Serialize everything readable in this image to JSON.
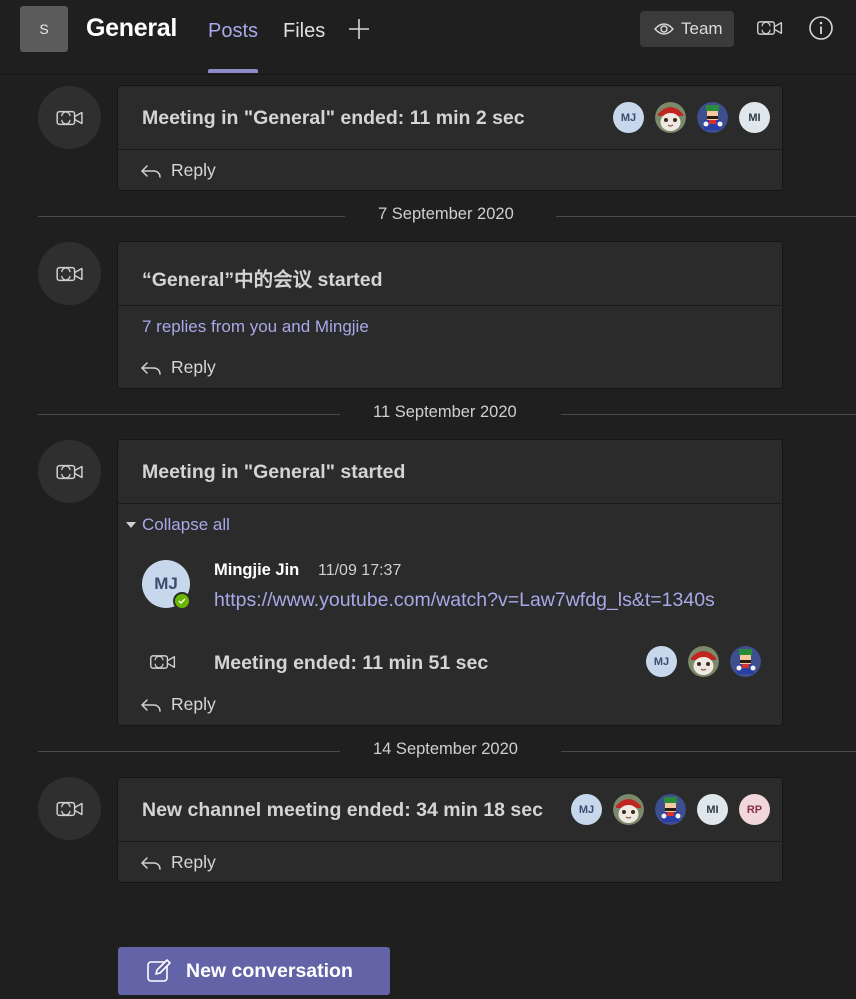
{
  "header": {
    "team_avatar_letter": "S",
    "channel_name": "General",
    "tabs": [
      {
        "label": "Posts",
        "active": true
      },
      {
        "label": "Files",
        "active": false
      }
    ],
    "team_button_label": "Team",
    "icons": [
      "eye-icon",
      "add-icon",
      "video-call-icon",
      "info-icon"
    ]
  },
  "conversations": [
    {
      "title": "Meeting in \"General\" ended: 11 min 2 sec",
      "participants": [
        "MJ",
        "cat-photo",
        "mario-character",
        "MI"
      ],
      "reply_label": "Reply"
    },
    {
      "date": "7 September 2020",
      "title": "“General”中的会议 started",
      "replies_summary": "7 replies from you and Mingjie",
      "reply_label": "Reply"
    },
    {
      "date": "11 September 2020",
      "title": "Meeting in \"General\" started",
      "collapse_label": "Collapse all",
      "message": {
        "avatar_initials": "MJ",
        "author": "Mingjie Jin",
        "timestamp": "11/09 17:37",
        "link": "https://www.youtube.com/watch?v=Law7wfdg_ls&t=1340s",
        "status": "available"
      },
      "meeting_end": {
        "text": "Meeting ended: 11 min 51 sec",
        "participants": [
          "MJ",
          "cat-photo",
          "mario-character"
        ]
      },
      "reply_label": "Reply"
    },
    {
      "date": "14 September 2020",
      "title": "New channel meeting ended: 34 min 18 sec",
      "participants": [
        "MJ",
        "cat-photo",
        "mario-character",
        "MI",
        "RP"
      ],
      "reply_label": "Reply"
    }
  ],
  "new_conversation_label": "New conversation",
  "colors": {
    "background": "#1f1f1f",
    "card": "#2b2b2b",
    "accent": "#6264a7",
    "link": "#a9a8e8",
    "presence": "#6bb700"
  }
}
